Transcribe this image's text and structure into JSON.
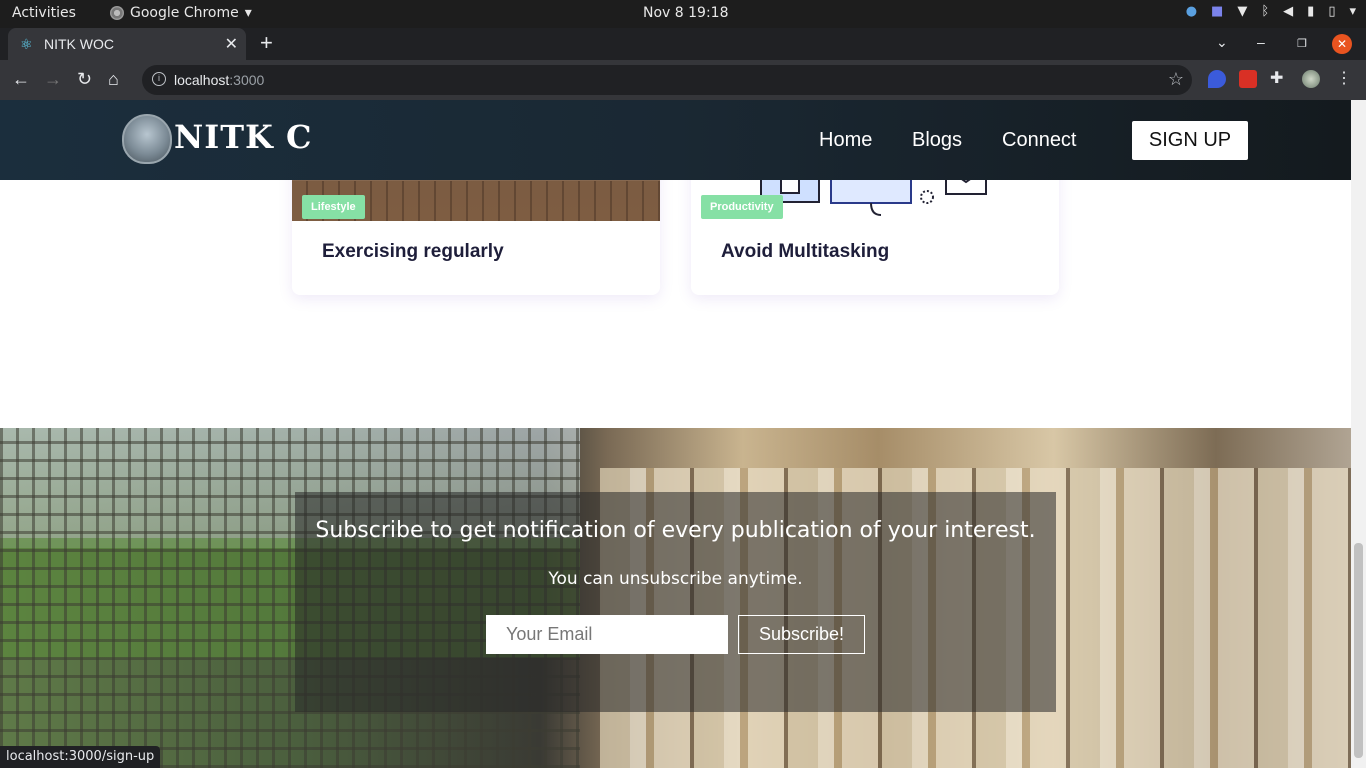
{
  "os": {
    "activities": "Activities",
    "app_name": "Google Chrome",
    "clock": "Nov 8  19:18"
  },
  "browser": {
    "tab_title": "NITK WOC",
    "url_host": "localhost",
    "url_port": ":3000",
    "status_url": "localhost:3000/sign-up"
  },
  "navbar": {
    "brand": "NITK C",
    "links": [
      "Home",
      "Blogs",
      "Connect"
    ],
    "signup": "SIGN UP"
  },
  "cards": [
    {
      "badge": "Lifestyle",
      "title": "Exercising regularly"
    },
    {
      "badge": "Productivity",
      "title": "Avoid Multitasking"
    }
  ],
  "subscribe": {
    "title": "Subscribe to get notification of every publication of your interest.",
    "note": "You can unsubscribe anytime.",
    "email_placeholder": "Your Email",
    "button": "Subscribe!"
  },
  "colors": {
    "badge_green": "#86e0a5",
    "navbar_bg": "#1b2e3d",
    "chrome_close": "#e95420"
  }
}
